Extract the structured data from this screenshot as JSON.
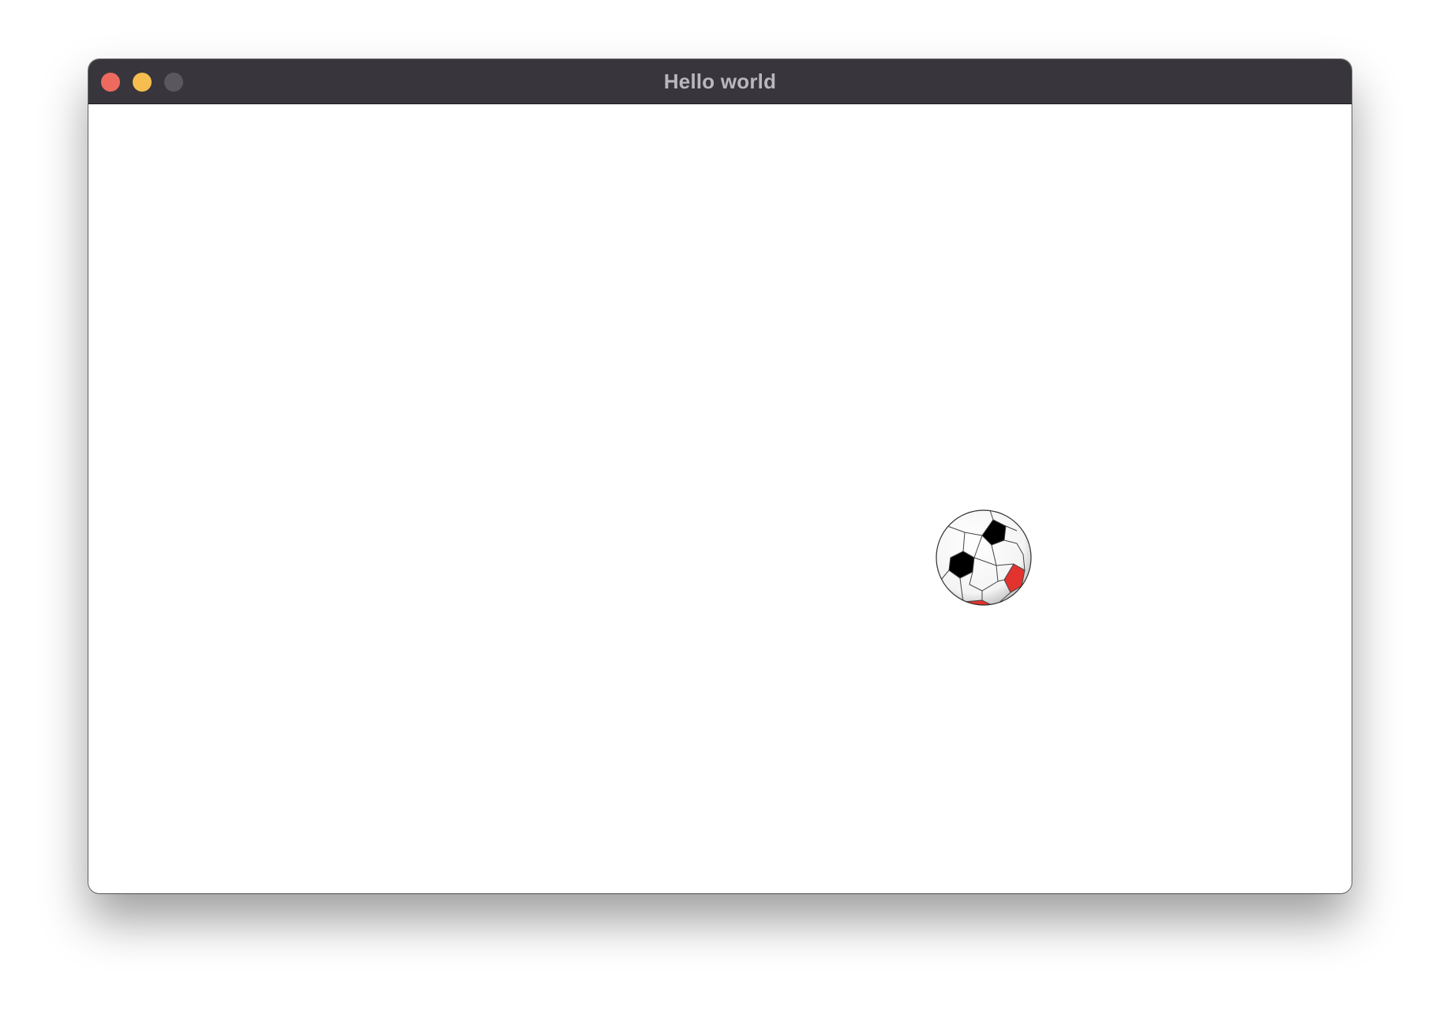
{
  "window": {
    "title": "Hello world",
    "controls": {
      "close_color": "#ee6a5f",
      "minimize_color": "#f5be4f",
      "zoom_color": "#5a585e"
    }
  },
  "content": {
    "ball": {
      "icon": "soccer-ball-icon",
      "patch_colors": [
        "#000000",
        "#e2332f",
        "#ffffff"
      ]
    }
  }
}
